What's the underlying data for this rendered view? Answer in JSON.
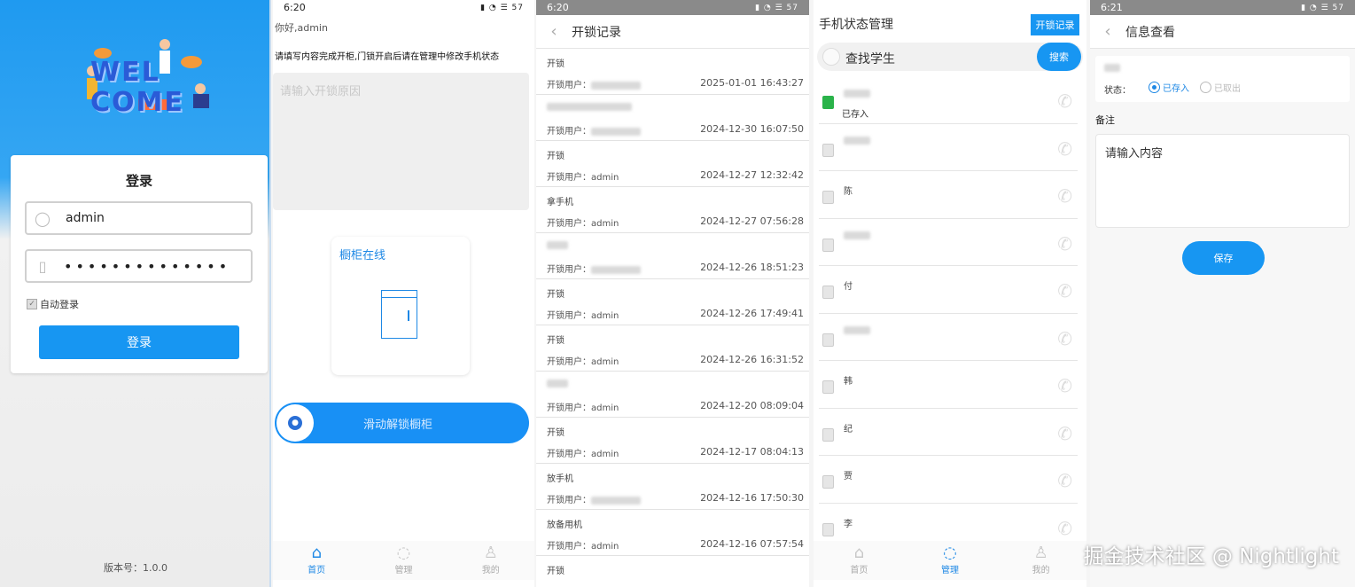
{
  "screen1": {
    "logo_text": "WELCOME",
    "login_title": "登录",
    "username_value": "admin",
    "password_mask": "••••••••••••••",
    "auto_login_label": "自动登录",
    "login_button": "登录",
    "version": "版本号：1.0.0"
  },
  "screen2": {
    "time": "6:20",
    "greeting": "你好,admin",
    "tip": "请填写内容完成开柜,门锁开启后请在管理中修改手机状态",
    "reason_placeholder": "请输入开锁原因",
    "cabinet_label": "橱柜在线",
    "slider_label": "滑动解锁橱柜",
    "tabs": [
      "首页",
      "管理",
      "我的"
    ]
  },
  "screen3": {
    "time": "6:20",
    "title": "开锁记录",
    "user_prefix": "开锁用户：",
    "records": [
      {
        "type": "开锁",
        "user": "",
        "time": "2025-01-01 16:43:27"
      },
      {
        "type": "",
        "user": "",
        "time": "2024-12-30 16:07:50"
      },
      {
        "type": "开锁",
        "user": "admin",
        "time": "2024-12-27 12:32:42"
      },
      {
        "type": "拿手机",
        "user": "admin",
        "time": "2024-12-27 07:56:28"
      },
      {
        "type": "",
        "user": "",
        "time": "2024-12-26 18:51:23"
      },
      {
        "type": "开锁",
        "user": "admin",
        "time": "2024-12-26 17:49:41"
      },
      {
        "type": "开锁",
        "user": "admin",
        "time": "2024-12-26 16:31:52"
      },
      {
        "type": "",
        "user": "admin",
        "time": "2024-12-20 08:09:04"
      },
      {
        "type": "开锁",
        "user": "admin",
        "time": "2024-12-17 08:04:13"
      },
      {
        "type": "放手机",
        "user": "",
        "time": "2024-12-16 17:50:30"
      },
      {
        "type": "放备用机",
        "user": "admin",
        "time": "2024-12-16 07:57:54"
      },
      {
        "type": "开锁",
        "user": "",
        "time": ""
      }
    ]
  },
  "screen4": {
    "time": "6:21",
    "title": "手机状态管理",
    "records_button": "开锁记录",
    "search_placeholder": "查找学生",
    "search_button": "搜索",
    "students": [
      {
        "name": "",
        "status": "已存入",
        "icon_color": "#2ab34a"
      },
      {
        "name": "",
        "status": ""
      },
      {
        "name": "陈",
        "status": ""
      },
      {
        "name": "",
        "status": ""
      },
      {
        "name": "付",
        "status": ""
      },
      {
        "name": "",
        "status": ""
      },
      {
        "name": "韩",
        "status": ""
      },
      {
        "name": "纪",
        "status": ""
      },
      {
        "name": "贾",
        "status": ""
      },
      {
        "name": "李",
        "status": ""
      }
    ],
    "tabs": [
      "首页",
      "管理",
      "我的"
    ]
  },
  "screen5": {
    "time": "6:21",
    "title": "信息查看",
    "name": "",
    "status_label": "状态：",
    "option_in": "已存入",
    "option_out": "已取出",
    "note_label": "备注",
    "note_placeholder": "请输入内容",
    "save_button": "保存"
  },
  "watermark": "掘金技术社区 @ Nightlight",
  "colors": {
    "primary": "#1796f2",
    "green": "#2ab34a"
  }
}
